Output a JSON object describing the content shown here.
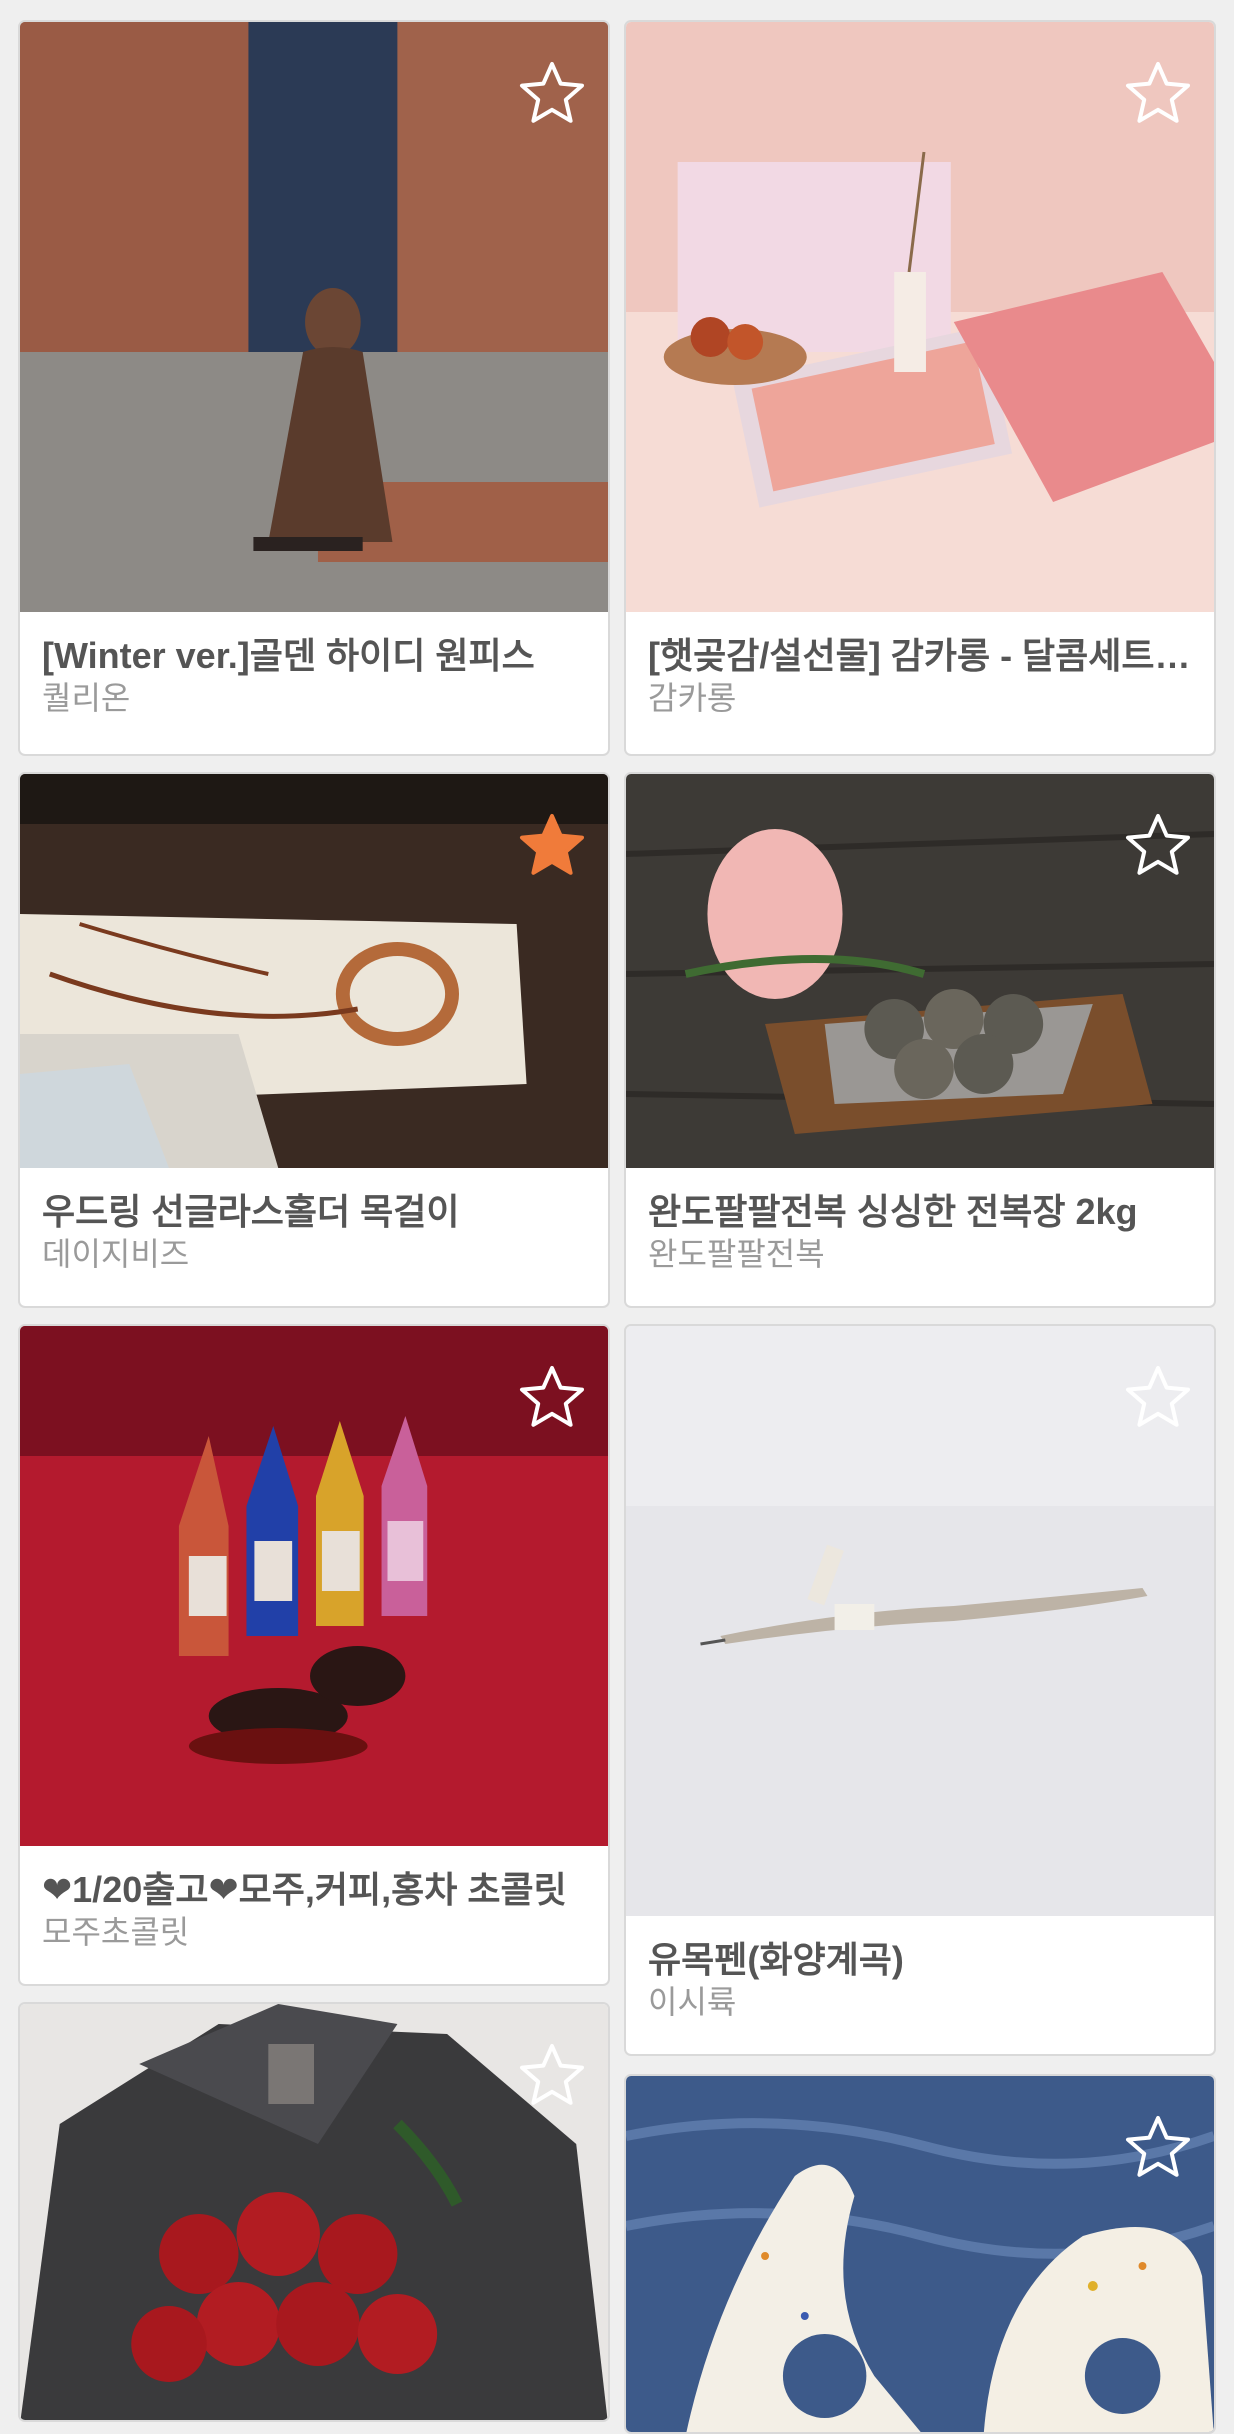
{
  "products": [
    {
      "title": "[Winter ver.]골덴 하이디 원피스",
      "shop": "퀄리온",
      "favorited": false,
      "image": "woman-in-brown-dress-photo"
    },
    {
      "title": "[햇곶감/설선물] 감카롱 - 달콤세트 (곶감말랭이)",
      "shop": "감카롱",
      "favorited": false,
      "image": "persimmon-gift-set-photo"
    },
    {
      "title": "우드링 선글라스홀더 목걸이",
      "shop": "데이지비즈",
      "favorited": true,
      "image": "wood-ring-necklace-photo"
    },
    {
      "title": "완도팔팔전복 싱싱한 전복장 2kg",
      "shop": "완도팔팔전복",
      "favorited": false,
      "image": "abalone-dish-photo"
    },
    {
      "title": "❤1/20출고❤모주,커피,홍차 초콜릿",
      "shop": "모주초콜릿",
      "favorited": false,
      "image": "bottle-chocolates-photo"
    },
    {
      "title": "유목펜(화양계곡)",
      "shop": "이시륙",
      "favorited": false,
      "image": "driftwood-pen-photo"
    },
    {
      "title": "",
      "shop": "",
      "favorited": false,
      "image": "red-rose-bouquet-photo"
    },
    {
      "title": "",
      "shop": "",
      "favorited": false,
      "image": "ceramic-rests-photo"
    }
  ],
  "icons": {
    "favorite_off": "star-outline-icon",
    "favorite_on": "star-filled-icon"
  },
  "colors": {
    "background": "#efefef",
    "title_text": "#555555",
    "shop_text": "#9a9a9a",
    "favorite_active": "#f07b3a",
    "favorite_inactive": "#ffffff"
  }
}
